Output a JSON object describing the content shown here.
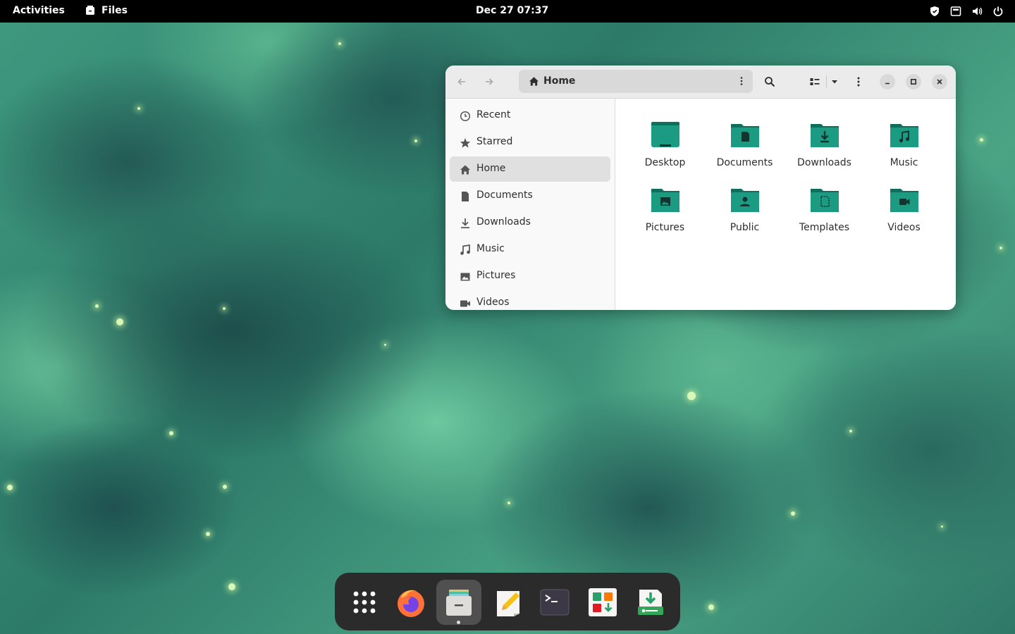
{
  "topbar": {
    "activities_label": "Activities",
    "app_name": "Files",
    "clock": "Dec 27  07:37",
    "tray_icons": [
      "shield-icon",
      "keyboard-icon",
      "volume-icon",
      "power-icon"
    ]
  },
  "window": {
    "path_label": "Home",
    "sidebar": {
      "items": [
        {
          "label": "Recent",
          "icon": "recent-icon"
        },
        {
          "label": "Starred",
          "icon": "star-icon"
        },
        {
          "label": "Home",
          "icon": "home-icon",
          "active": true
        },
        {
          "label": "Documents",
          "icon": "document-icon"
        },
        {
          "label": "Downloads",
          "icon": "download-icon"
        },
        {
          "label": "Music",
          "icon": "music-icon"
        },
        {
          "label": "Pictures",
          "icon": "picture-icon"
        },
        {
          "label": "Videos",
          "icon": "video-icon"
        }
      ]
    },
    "folders": [
      {
        "label": "Desktop",
        "icon": "desktop-folder-icon"
      },
      {
        "label": "Documents",
        "icon": "documents-folder-icon"
      },
      {
        "label": "Downloads",
        "icon": "downloads-folder-icon"
      },
      {
        "label": "Music",
        "icon": "music-folder-icon"
      },
      {
        "label": "Pictures",
        "icon": "pictures-folder-icon"
      },
      {
        "label": "Public",
        "icon": "public-folder-icon"
      },
      {
        "label": "Templates",
        "icon": "templates-folder-icon"
      },
      {
        "label": "Videos",
        "icon": "videos-folder-icon"
      }
    ]
  },
  "dock": {
    "apps": [
      "app-grid-icon",
      "firefox-icon",
      "files-icon",
      "text-editor-icon",
      "terminal-icon",
      "software-icon",
      "installer-icon"
    ]
  },
  "colors": {
    "folder_teal": "#1a9b82",
    "folder_dark": "#0f6e5c",
    "topbar": "#000000",
    "dock": "#2b2b2b"
  }
}
